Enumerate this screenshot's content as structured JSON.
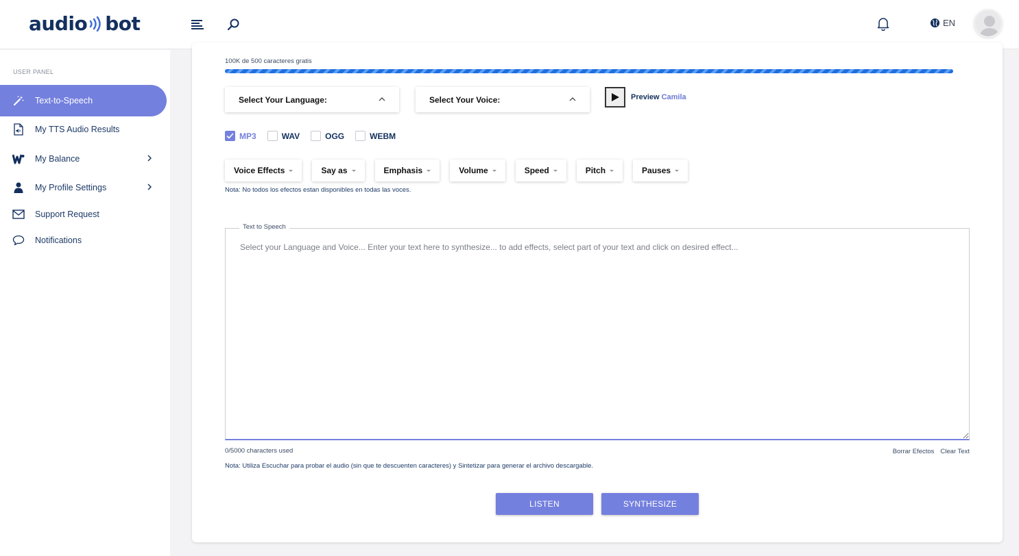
{
  "header": {
    "logo_left": "audio",
    "logo_right": "bot",
    "language": "EN"
  },
  "sidebar": {
    "heading": "USER PANEL",
    "items": [
      {
        "label": "Text-to-Speech",
        "icon": "magic-wand-icon",
        "active": true
      },
      {
        "label": "My TTS Audio Results",
        "icon": "audio-file-icon"
      },
      {
        "label": "My Balance",
        "icon": "wallet-icon",
        "has_submenu": true
      },
      {
        "label": "My Profile Settings",
        "icon": "user-icon",
        "has_submenu": true
      },
      {
        "label": "Support Request",
        "icon": "envelope-icon"
      },
      {
        "label": "Notifications",
        "icon": "chat-bubble-icon"
      }
    ]
  },
  "main": {
    "quota_text": "100K de 500 caracteres gratis",
    "progress_fraction": 1.0,
    "language_select": "Select Your Language:",
    "voice_select": "Select Your Voice:",
    "preview_label": "Preview",
    "preview_voice": "Camila",
    "formats": [
      {
        "label": "MP3",
        "checked": true
      },
      {
        "label": "WAV",
        "checked": false
      },
      {
        "label": "OGG",
        "checked": false
      },
      {
        "label": "WEBM",
        "checked": false
      }
    ],
    "effects": [
      "Voice Effects",
      "Say as",
      "Emphasis",
      "Volume",
      "Speed",
      "Pitch",
      "Pauses"
    ],
    "effects_note": "Nota: No todos los efectos estan disponibles en todas las voces.",
    "textarea_legend": "Text to Speech",
    "textarea_placeholder": "Select your Language and Voice... Enter your text here to synthesize... to add effects, select part of your text and click on desired effect...",
    "char_count": "0/5000 characters used",
    "clear_effects": "Borrar Efectos",
    "clear_text": "Clear Text",
    "usage_note": "Nota: Utiliza Escuchar para probar el audio (sin que te descuenten caracteres) y Sintetizar para generar el archivo descargable.",
    "listen_button": "LISTEN",
    "synthesize_button": "SYNTHESIZE"
  },
  "colors": {
    "accent": "#7480de",
    "navy": "#13305e",
    "progress": "#1e6fe0"
  }
}
